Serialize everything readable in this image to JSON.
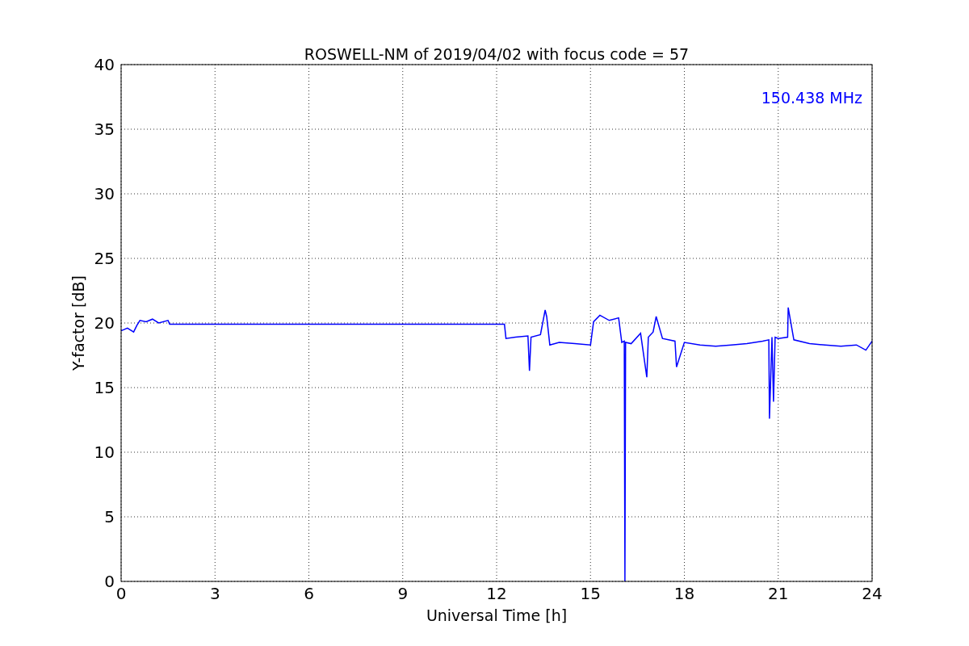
{
  "chart_data": {
    "type": "line",
    "title": "ROSWELL-NM of 2019/04/02 with focus code = 57",
    "xlabel": "Universal Time [h]",
    "ylabel": "Y-factor [dB]",
    "x": [
      0,
      0.2,
      0.4,
      0.5,
      0.6,
      0.8,
      1.0,
      1.2,
      1.5,
      1.55,
      12.25,
      12.3,
      12.6,
      13.0,
      13.05,
      13.1,
      13.4,
      13.55,
      13.6,
      13.7,
      14.0,
      14.5,
      15.0,
      15.1,
      15.3,
      15.6,
      15.9,
      16.0,
      16.08,
      16.1,
      16.12,
      16.3,
      16.6,
      16.8,
      16.85,
      17.0,
      17.1,
      17.3,
      17.7,
      17.75,
      18.0,
      18.5,
      19.0,
      19.5,
      20.0,
      20.5,
      20.7,
      20.72,
      20.8,
      20.85,
      20.9,
      21.0,
      21.3,
      21.32,
      21.5,
      22.0,
      22.5,
      23.0,
      23.5,
      23.8,
      24.0
    ],
    "series": [
      {
        "name": "150.438 MHz",
        "color": "#0000ff",
        "values": [
          19.4,
          19.6,
          19.3,
          19.8,
          20.2,
          20.1,
          20.3,
          20.0,
          20.2,
          19.9,
          19.9,
          18.8,
          18.9,
          19.0,
          16.3,
          18.9,
          19.1,
          21.0,
          20.5,
          18.3,
          18.5,
          18.4,
          18.3,
          20.1,
          20.6,
          20.2,
          20.4,
          18.5,
          18.6,
          0,
          18.5,
          18.4,
          19.2,
          15.8,
          18.9,
          19.3,
          20.5,
          18.8,
          18.6,
          16.6,
          18.5,
          18.3,
          18.2,
          18.3,
          18.4,
          18.6,
          18.7,
          12.6,
          18.9,
          13.9,
          18.9,
          18.8,
          18.9,
          21.2,
          18.7,
          18.4,
          18.3,
          18.2,
          18.3,
          17.9,
          18.6
        ]
      }
    ],
    "xlim": [
      0,
      24
    ],
    "ylim": [
      0,
      40
    ],
    "xticks": [
      0,
      3,
      6,
      9,
      12,
      15,
      18,
      21,
      24
    ],
    "yticks": [
      0,
      5,
      10,
      15,
      20,
      25,
      30,
      35,
      40
    ],
    "grid": true
  }
}
